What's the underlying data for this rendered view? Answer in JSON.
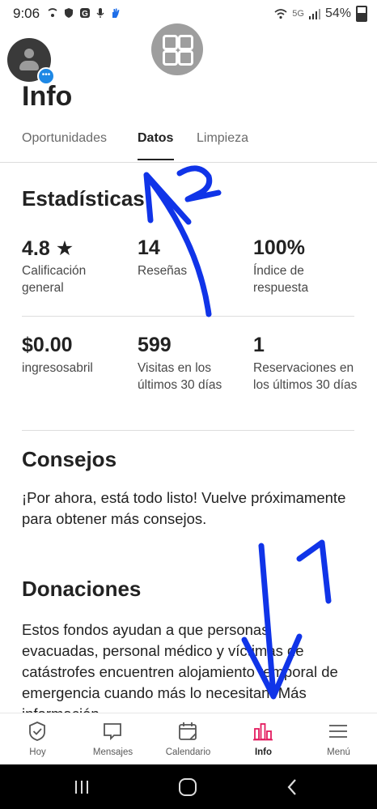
{
  "status_bar": {
    "time": "9:06",
    "network": "5G",
    "battery": "54%"
  },
  "page": {
    "title": "Info"
  },
  "tabs": [
    {
      "label": "Oportunidades",
      "active": false
    },
    {
      "label": "Datos",
      "active": true
    },
    {
      "label": "Limpieza",
      "active": false
    }
  ],
  "stats": {
    "heading": "Estadísticas",
    "items": [
      {
        "value": "4.8 ★",
        "label": "Calificación general"
      },
      {
        "value": "14",
        "label": "Reseñas"
      },
      {
        "value": "100%",
        "label": "Índice de respuesta"
      },
      {
        "value": "$0.00",
        "label": "ingresosabril"
      },
      {
        "value": "599",
        "label": "Visitas en los últimos 30 días"
      },
      {
        "value": "1",
        "label": "Reservaciones en los últimos 30 días"
      }
    ]
  },
  "tips": {
    "heading": "Consejos",
    "text": "¡Por ahora, está todo listo! Vuelve próximamente para obtener más consejos."
  },
  "donations": {
    "heading": "Donaciones",
    "text": "Estos fondos ayudan a que personas evacuadas, personal médico y víctimas de catástrofes encuentren alojamiento temporal de emergencia cuando más lo necesitan. Más información"
  },
  "bottom_nav": [
    {
      "label": "Hoy",
      "icon": "checkmark-badge-icon",
      "active": false
    },
    {
      "label": "Mensajes",
      "icon": "chat-bubble-icon",
      "active": false
    },
    {
      "label": "Calendario",
      "icon": "calendar-icon",
      "active": false
    },
    {
      "label": "Info",
      "icon": "bar-chart-icon",
      "active": true
    },
    {
      "label": "Menú",
      "icon": "hamburger-menu-icon",
      "active": false
    }
  ],
  "annotations": {
    "number_one": "1",
    "number_two": "2",
    "ink_color": "#1034e8"
  },
  "colors": {
    "accent": "#e31c5f",
    "text": "#222222",
    "secondary_text": "#6a6a6a",
    "divider": "#dddddd"
  }
}
